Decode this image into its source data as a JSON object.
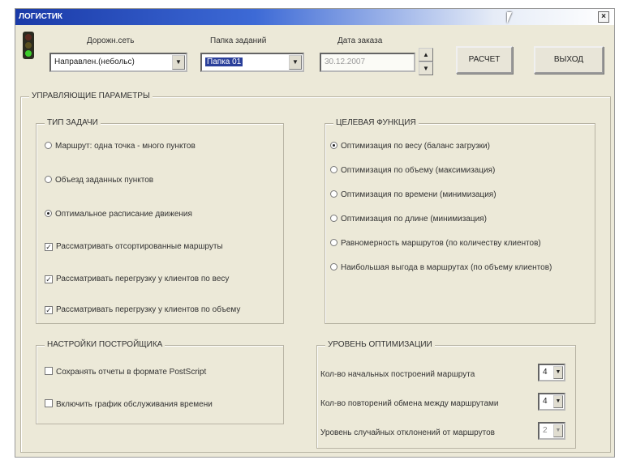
{
  "window": {
    "title": "ЛОГИСТИК",
    "close_label": "×"
  },
  "top": {
    "date_source_label": "Дорожн.сеть",
    "date_source_value": "Направлен.(небольс)",
    "field_label": "Папка заданий",
    "field_value": "Папка 01",
    "date_label": "Дата заказа",
    "date_value": "30.12.2007",
    "calc_button": "РАСЧЕТ",
    "exit_button": "ВЫХОД"
  },
  "params": {
    "title": "УПРАВЛЯЮЩИЕ ПАРАМЕТРЫ",
    "task_type": {
      "title": "ТИП ЗАДАЧИ",
      "options": [
        {
          "label": "Маршрут: одна точка - много пунктов",
          "kind": "radio",
          "checked": false
        },
        {
          "label": "Объезд заданных пунктов",
          "kind": "radio",
          "checked": false
        },
        {
          "label": "Оптимальное расписание движения",
          "kind": "radio",
          "checked": true
        },
        {
          "label": "Рассматривать отсортированные маршруты",
          "kind": "check",
          "checked": true
        },
        {
          "label": "Рассматривать перегрузку у клиентов по весу",
          "kind": "check",
          "checked": true
        },
        {
          "label": "Рассматривать перегрузку у клиентов по объему",
          "kind": "check",
          "checked": true
        }
      ]
    },
    "target_function": {
      "title": "ЦЕЛЕВАЯ ФУНКЦИЯ",
      "options": [
        {
          "label": "Оптимизация по весу (баланс загрузки)",
          "checked": true
        },
        {
          "label": "Оптимизация по объему (максимизация)",
          "checked": false
        },
        {
          "label": "Оптимизация по времени (минимизация)",
          "checked": false
        },
        {
          "label": "Оптимизация по длине (минимизация)",
          "checked": false
        },
        {
          "label": "Равномерность маршрутов (по количеству клиентов)",
          "checked": false
        },
        {
          "label": "Наибольшая выгода в маршрутах (по объему клиентов)",
          "checked": false
        }
      ]
    },
    "tuner": {
      "title": "НАСТРОЙКИ ПОСТРОЙЩИКА",
      "options": [
        {
          "label": "Сохранять отчеты в формате PostScript",
          "checked": false
        },
        {
          "label": "Включить график обслуживания времени",
          "checked": false
        }
      ]
    },
    "optimization_level": {
      "title": "УРОВЕНЬ ОПТИМИЗАЦИИ",
      "rows": [
        {
          "label": "Кол-во начальных построений маршрута",
          "value": "4"
        },
        {
          "label": "Кол-во повторений обмена между маршрутами",
          "value": "4"
        },
        {
          "label": "Уровень случайных отклонений от маршрутов",
          "value": "2"
        }
      ]
    }
  },
  "colors": {
    "title_gradient_start": "#1a3aa8",
    "window_bg": "#ece9d8",
    "selection": "#2a3f9a"
  },
  "icons": {
    "app": "traffic-light-icon",
    "cursor": "mouse-pointer-icon",
    "close": "close-icon"
  }
}
